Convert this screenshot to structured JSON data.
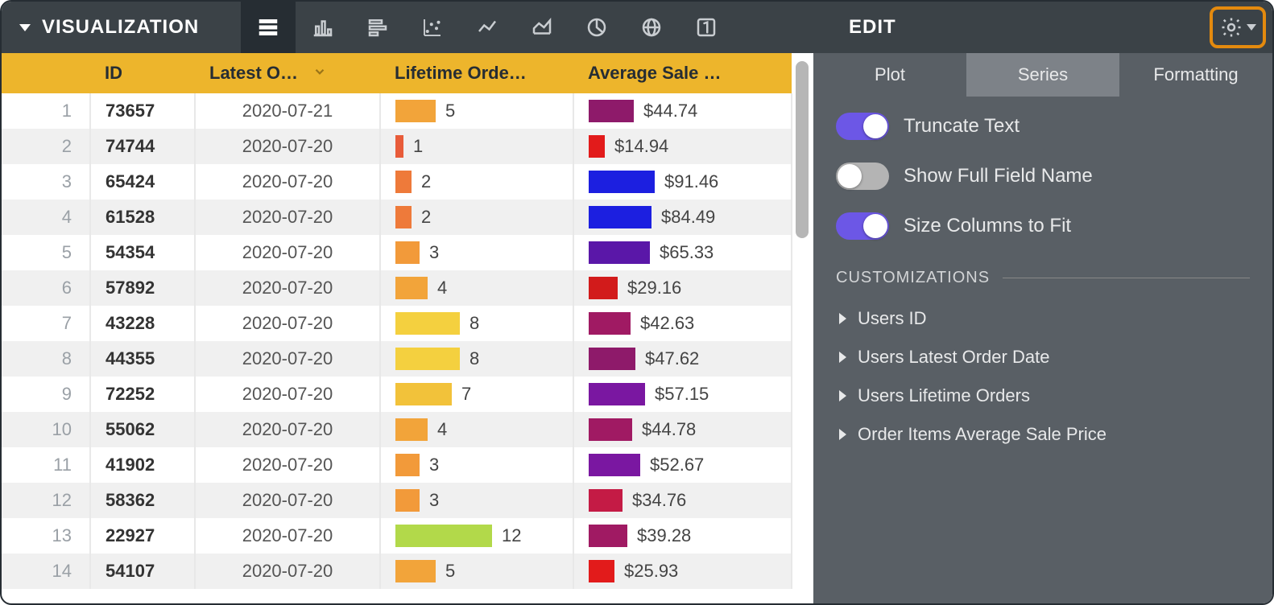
{
  "topbar": {
    "title": "VISUALIZATION",
    "edit": "EDIT"
  },
  "visTypes": [
    "table",
    "column",
    "bar",
    "scatter",
    "line",
    "area",
    "pie",
    "map",
    "single"
  ],
  "columns": {
    "id": "ID",
    "latest": "Latest O…",
    "orders": "Lifetime Orde…",
    "avg": "Average Sale …"
  },
  "rows": [
    {
      "n": 1,
      "id": "73657",
      "date": "2020-07-21",
      "orders": 5,
      "ocolor": "#f2a43a",
      "avg": "$44.74",
      "aw": 56,
      "acolor": "#8e1a6a"
    },
    {
      "n": 2,
      "id": "74744",
      "date": "2020-07-20",
      "orders": 1,
      "ocolor": "#e85c3a",
      "avg": "$14.94",
      "aw": 20,
      "acolor": "#e21b1b"
    },
    {
      "n": 3,
      "id": "65424",
      "date": "2020-07-20",
      "orders": 2,
      "ocolor": "#ee7a3a",
      "avg": "$91.46",
      "aw": 82,
      "acolor": "#1c1fe0"
    },
    {
      "n": 4,
      "id": "61528",
      "date": "2020-07-20",
      "orders": 2,
      "ocolor": "#ee7a3a",
      "avg": "$84.49",
      "aw": 78,
      "acolor": "#1c1fe0"
    },
    {
      "n": 5,
      "id": "54354",
      "date": "2020-07-20",
      "orders": 3,
      "ocolor": "#f29a3a",
      "avg": "$65.33",
      "aw": 76,
      "acolor": "#5a17a8"
    },
    {
      "n": 6,
      "id": "57892",
      "date": "2020-07-20",
      "orders": 4,
      "ocolor": "#f2a43a",
      "avg": "$29.16",
      "aw": 36,
      "acolor": "#d21b1b"
    },
    {
      "n": 7,
      "id": "43228",
      "date": "2020-07-20",
      "orders": 8,
      "ocolor": "#f4d03f",
      "avg": "$42.63",
      "aw": 52,
      "acolor": "#a01a63"
    },
    {
      "n": 8,
      "id": "44355",
      "date": "2020-07-20",
      "orders": 8,
      "ocolor": "#f4d03f",
      "avg": "$47.62",
      "aw": 58,
      "acolor": "#8e1a6a"
    },
    {
      "n": 9,
      "id": "72252",
      "date": "2020-07-20",
      "orders": 7,
      "ocolor": "#f2c23a",
      "avg": "$57.15",
      "aw": 70,
      "acolor": "#7a17a1"
    },
    {
      "n": 10,
      "id": "55062",
      "date": "2020-07-20",
      "orders": 4,
      "ocolor": "#f2a43a",
      "avg": "$44.78",
      "aw": 54,
      "acolor": "#a01a63"
    },
    {
      "n": 11,
      "id": "41902",
      "date": "2020-07-20",
      "orders": 3,
      "ocolor": "#f29a3a",
      "avg": "$52.67",
      "aw": 64,
      "acolor": "#7a17a1"
    },
    {
      "n": 12,
      "id": "58362",
      "date": "2020-07-20",
      "orders": 3,
      "ocolor": "#f29a3a",
      "avg": "$34.76",
      "aw": 42,
      "acolor": "#c41b45"
    },
    {
      "n": 13,
      "id": "22927",
      "date": "2020-07-20",
      "orders": 12,
      "ocolor": "#b2d94a",
      "avg": "$39.28",
      "aw": 48,
      "acolor": "#a01a63"
    },
    {
      "n": 14,
      "id": "54107",
      "date": "2020-07-20",
      "orders": 5,
      "ocolor": "#f2a43a",
      "avg": "$25.93",
      "aw": 32,
      "acolor": "#e21b1b"
    }
  ],
  "panel": {
    "tabs": [
      "Plot",
      "Series",
      "Formatting"
    ],
    "activeTab": 1,
    "toggles": [
      {
        "label": "Truncate Text",
        "on": true
      },
      {
        "label": "Show Full Field Name",
        "on": false
      },
      {
        "label": "Size Columns to Fit",
        "on": true
      }
    ],
    "sectLabel": "CUSTOMIZATIONS",
    "custom": [
      "Users ID",
      "Users Latest Order Date",
      "Users Lifetime Orders",
      "Order Items Average Sale Price"
    ]
  },
  "ordersMax": 12
}
